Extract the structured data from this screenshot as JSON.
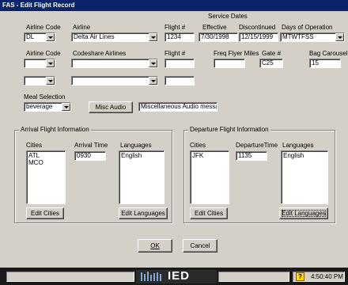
{
  "window": {
    "title": "FAS - Edit Flight Record"
  },
  "labels": {
    "service_dates": "Service Dates",
    "airline_code": "Airline Code",
    "airline": "Airline",
    "flight_no": "Flight #",
    "effective": "Effective",
    "discontinued": "Discontinued",
    "days_of_operation": "Days of Operation",
    "codeshare_airline_code": "Airline Code",
    "codeshare_airlines": "Codeshare Airlines",
    "codeshare_flight_no": "Flight #",
    "freq_flyer_miles": "Freq Flyer Miles",
    "gate": "Gate #",
    "bag_carousel": "Bag Carousel",
    "meal_selection": "Meal Selection"
  },
  "fields": {
    "airline_code": "DL",
    "airline": "Delta Air Lines",
    "flight_no": "1234",
    "effective": "7/30/1998",
    "discontinued": "12/15/1999",
    "days_of_operation": "MTWTFSS",
    "codeshare_airline_code_1": "",
    "codeshare_airline_1": "",
    "codeshare_flight_1": "",
    "codeshare_airline_code_2": "",
    "codeshare_airline_2": "",
    "codeshare_flight_2": "",
    "freq_flyer_miles": "",
    "gate": "C25",
    "bag_carousel": "15",
    "meal_selection": "beverage",
    "misc_audio_text": "Miscellaneous Audio messa"
  },
  "buttons": {
    "misc_audio": "Misc Audio",
    "ok": "OK",
    "cancel": "Cancel"
  },
  "arrival": {
    "title": "Arrival Flight Information",
    "cities_label": "Cities",
    "time_label": "Arrival Time",
    "languages_label": "Languages",
    "cities": [
      "ATL",
      "MCO"
    ],
    "time": "0930",
    "languages": [
      "English"
    ],
    "edit_cities": "Edit Cities",
    "edit_languages": "Edit Languages"
  },
  "departure": {
    "title": "Departure Flight Information",
    "cities_label": "Cities",
    "time_label": "DepartureTime",
    "languages_label": "Languages",
    "cities": [
      "JFK"
    ],
    "time": "1135",
    "languages": [
      "English"
    ],
    "edit_cities": "Edit Cities",
    "edit_languages": "Edit Languages"
  },
  "taskbar": {
    "logo_text": "IED",
    "clock": "4:50:40 PM",
    "tray_icon": "question-icon"
  }
}
